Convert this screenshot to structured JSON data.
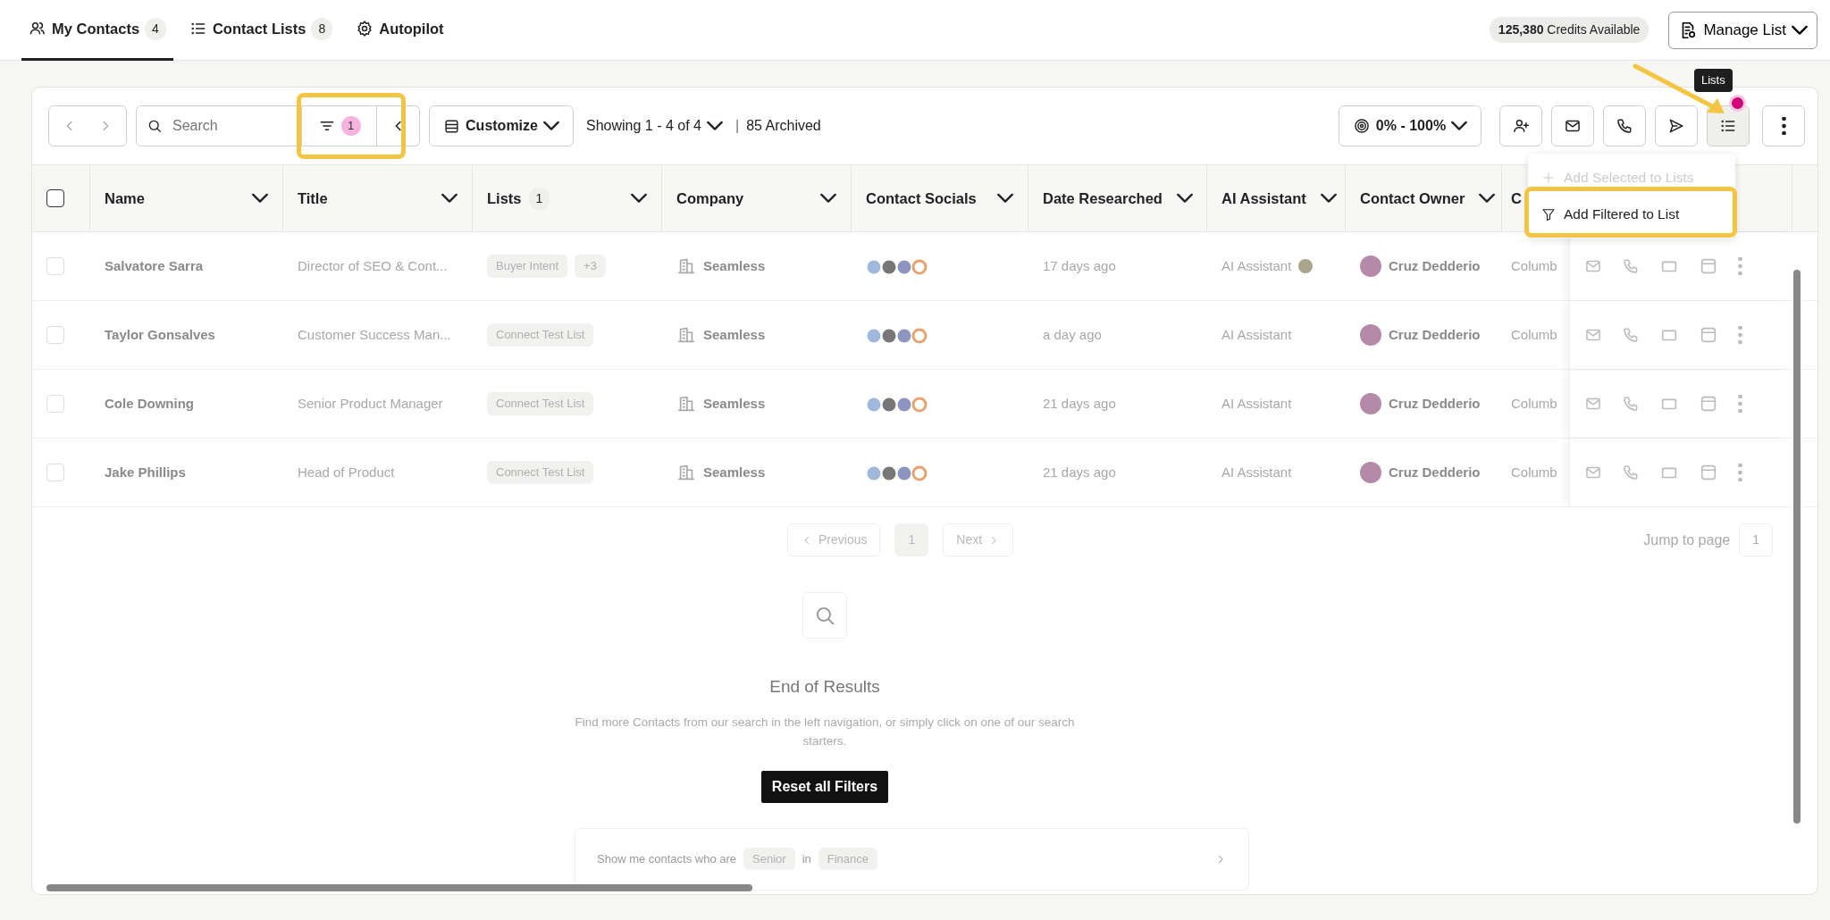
{
  "tabs": [
    {
      "label": "My Contacts",
      "count": "4",
      "kind": "users",
      "selected": true
    },
    {
      "label": "Contact Lists",
      "count": "8",
      "kind": "list",
      "selected": false
    },
    {
      "label": "Autopilot",
      "kind": "gear",
      "selected": false
    }
  ],
  "credits": {
    "amount": "125,380",
    "label": "Credits Available"
  },
  "manage_button": "Manage List",
  "toolbar": {
    "search_placeholder": "Search",
    "filter_count": "1",
    "customize": "Customize",
    "showing": "Showing 1 - 4 of 4",
    "separator": "|",
    "archived": "85 Archived",
    "score_range": "0% - 100%"
  },
  "action_buttons": [
    {
      "kind": "user-plus",
      "selected": false
    },
    {
      "kind": "mail",
      "selected": false
    },
    {
      "kind": "phone",
      "selected": false
    },
    {
      "kind": "send",
      "selected": false
    },
    {
      "kind": "list",
      "selected": true
    },
    {
      "kind": "more",
      "selected": false
    }
  ],
  "tooltip": "Lists",
  "menu": [
    {
      "label": "Add Selected to Lists",
      "kind": "plus",
      "disabled": true
    },
    {
      "label": "Add Filtered to List",
      "kind": "funnel",
      "disabled": false
    }
  ],
  "table": {
    "select_all_checked": false,
    "columns": [
      {
        "label": "Name"
      },
      {
        "label": "Title"
      },
      {
        "label": "Lists",
        "count": "1"
      },
      {
        "label": "Company"
      },
      {
        "label": "Contact Socials"
      },
      {
        "label": "Date Researched"
      },
      {
        "label": "AI Assistant"
      },
      {
        "label": "Contact Owner"
      },
      {
        "label": "C"
      }
    ],
    "rows": [
      {
        "checked": false,
        "name": "Salvatore Sarra",
        "title": "Director of SEO & Cont...",
        "lists": [
          "Buyer Intent",
          "+3"
        ],
        "company": "Seamless",
        "date": "17 days ago",
        "ai": "AI Assistant",
        "owner": "Cruz Dedderio",
        "column_9": "Columb"
      },
      {
        "checked": false,
        "name": "Taylor Gonsalves",
        "title": "Customer Success Man...",
        "lists": [
          "Connect Test List"
        ],
        "company": "Seamless",
        "date": "a day ago",
        "ai": "AI Assistant",
        "owner": "Cruz Dedderio",
        "column_9": "Columb"
      },
      {
        "checked": false,
        "name": "Cole Downing",
        "title": "Senior Product Manager",
        "lists": [
          "Connect Test List"
        ],
        "company": "Seamless",
        "date": "21 days ago",
        "ai": "AI Assistant",
        "owner": "Cruz Dedderio",
        "column_9": "Columb"
      },
      {
        "checked": false,
        "name": "Jake Phillips",
        "title": "Head of Product",
        "lists": [
          "Connect Test List"
        ],
        "company": "Seamless",
        "date": "21 days ago",
        "ai": "AI Assistant",
        "owner": "Cruz Dedderio",
        "column_9": "Columb"
      }
    ]
  },
  "pagination": {
    "previous": "Previous",
    "page": "1",
    "next": "Next",
    "jump_label": "Jump to page",
    "jump_value": "1"
  },
  "empty_state": {
    "title": "End of Results",
    "text": "Find more Contacts from our search in the left navigation, or simply click on one of our search starters.",
    "button": "Reset all Filters"
  },
  "suggestion": {
    "prefix": "Show me contacts who are",
    "seniority": "Senior",
    "joiner": "in",
    "department": "Finance"
  }
}
